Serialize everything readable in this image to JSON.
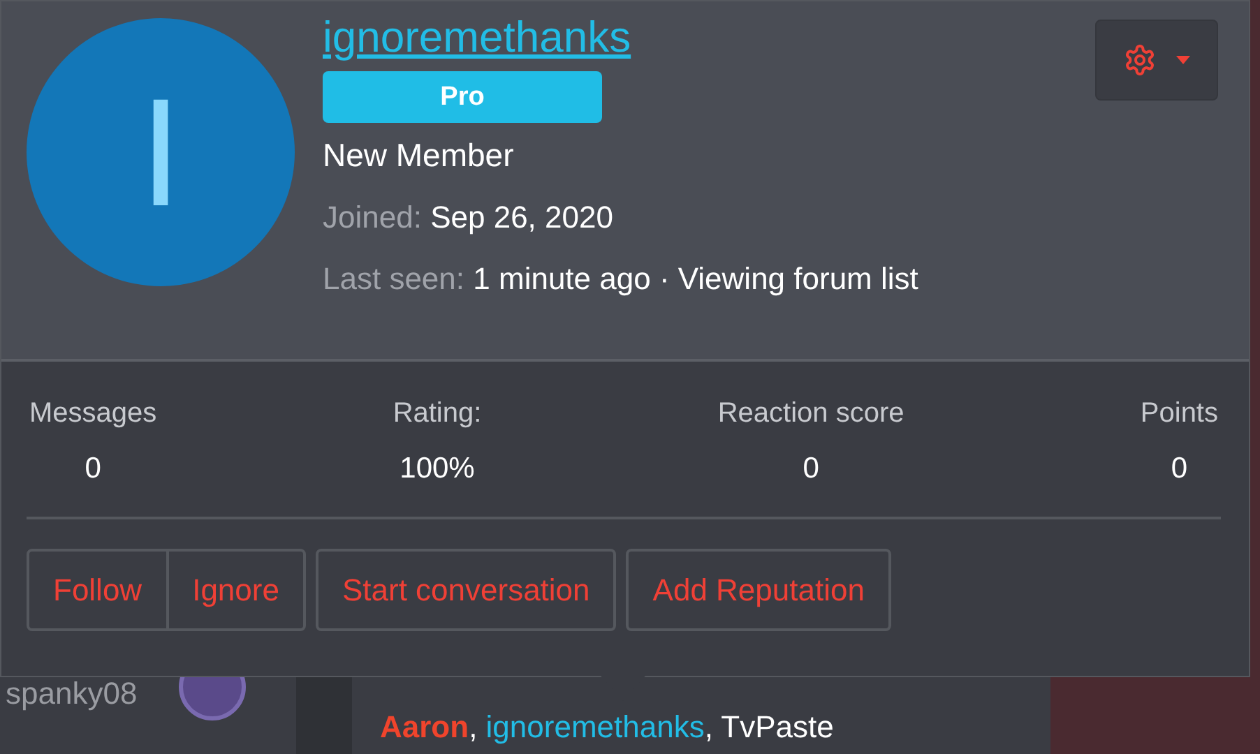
{
  "profile": {
    "avatar_letter": "I",
    "username": "ignoremethanks",
    "badge": "Pro",
    "title": "New Member",
    "details": [
      {
        "label": "Joined:",
        "value": "Sep 26, 2020"
      },
      {
        "label": "Last seen:",
        "value": "1 minute ago · Viewing forum list"
      }
    ]
  },
  "stats": [
    {
      "label": "Messages",
      "value": "0"
    },
    {
      "label": "Rating:",
      "value": "100%"
    },
    {
      "label": "Reaction score",
      "value": "0"
    },
    {
      "label": "Points",
      "value": "0"
    }
  ],
  "button_groups": [
    [
      "Follow",
      "Ignore"
    ],
    [
      "Start conversation"
    ],
    [
      "Add Reputation"
    ]
  ],
  "background": {
    "member_name": "spanky08",
    "reactions": [
      {
        "name": "Aaron",
        "color": "#f0442c"
      },
      {
        "name": "ignoremethanks",
        "color": "#22bde6"
      },
      {
        "name": "TvPaste",
        "color": "#ffffff"
      }
    ],
    "separator": ", "
  }
}
